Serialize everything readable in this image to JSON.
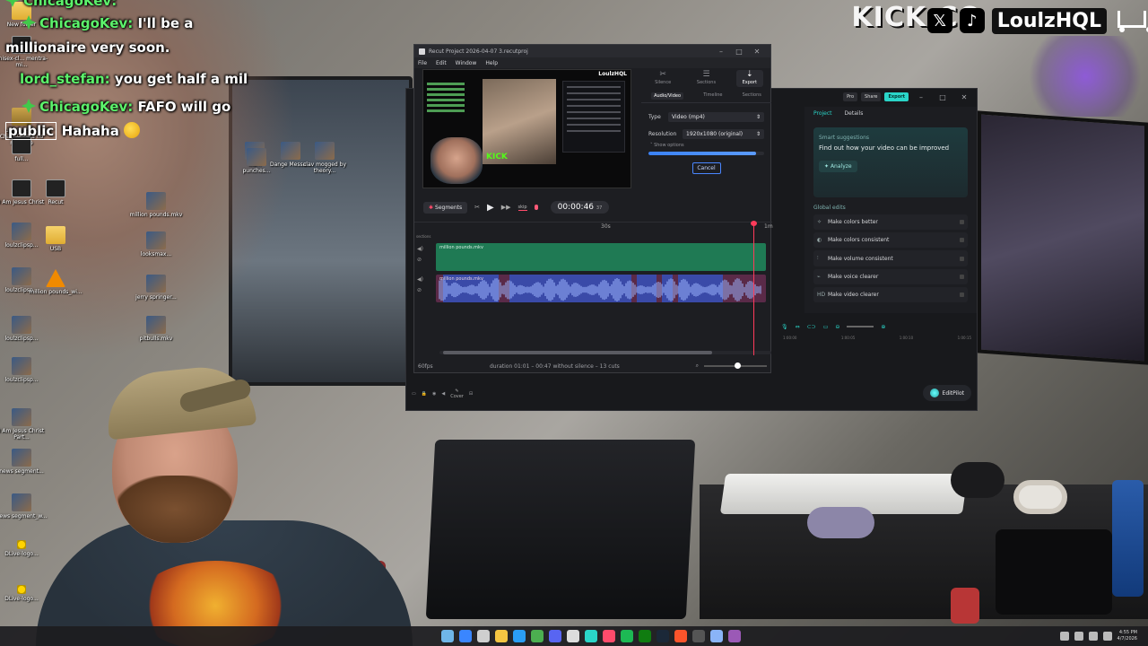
{
  "chat": [
    {
      "user": "ChicagoKev:",
      "color": "#5cf26b",
      "badge": "green",
      "message": "I'll be a millionaire very soon."
    },
    {
      "user": "lord_stefan:",
      "color": "#5cf26b",
      "badge": "none",
      "message": "you get half a mil"
    },
    {
      "user": "ChicagoKev:",
      "color": "#5cf26b",
      "badge": "green",
      "message": "FAFO will go",
      "message2": "public",
      "message3": "Hahaha"
    }
  ],
  "brand": {
    "kick": "KICK.CO",
    "name": "LoulzHQL",
    "x_icon": "x-logo-icon",
    "tiktok_icon": "tiktok-logo-icon",
    "cart_icon": "shopping-cart-icon"
  },
  "desktop_icons": [
    {
      "label": "New folder",
      "type": "folder"
    },
    {
      "label": "unisex-cl... mentra-mi...",
      "type": "app"
    },
    {
      "label": "unisex-clu... ChatTTSBeta no node.zip",
      "type": "zip"
    },
    {
      "label": "full...",
      "type": "app"
    },
    {
      "label": "I Am Jesus Christ",
      "type": "app"
    },
    {
      "label": "Recut",
      "type": "app"
    },
    {
      "label": "million pounds.mkv",
      "type": "video"
    },
    {
      "label": "loulzclipsp...",
      "type": "video"
    },
    {
      "label": "USB",
      "type": "folder"
    },
    {
      "label": "looksmax...",
      "type": "video"
    },
    {
      "label": "loulzclipsp...",
      "type": "video"
    },
    {
      "label": "million pounds_wi...",
      "type": "vlc"
    },
    {
      "label": "jerry springer...",
      "type": "video"
    },
    {
      "label": "loulzclipsp...",
      "type": "video"
    },
    {
      "label": "pitbulls.mkv",
      "type": "video"
    },
    {
      "label": "loulzclipsp...",
      "type": "video"
    },
    {
      "label": "I Am Jesus Christ Part...",
      "type": "video"
    },
    {
      "label": "news segment...",
      "type": "video"
    },
    {
      "label": "news segment_w...",
      "type": "video"
    },
    {
      "label": "DLive-logo...",
      "type": "dlive"
    },
    {
      "label": "DLive-logo...",
      "type": "dlive"
    },
    {
      "label": "kia...",
      "type": "video"
    },
    {
      "label": "punches...",
      "type": "video"
    },
    {
      "label": "Dange Messa...",
      "type": "video"
    },
    {
      "label": "clav mogged by theory...",
      "type": "video"
    }
  ],
  "recut": {
    "title": "Recut Project 2026-04-07 3.recutproj",
    "menu": [
      "File",
      "Edit",
      "Window",
      "Help"
    ],
    "preview_brand": "LoulzHQL",
    "preview_kick": "KICK",
    "segments_label": "Segments",
    "skip_label": "skip",
    "time_main": "00:00:46",
    "time_frac": "37",
    "side_tabs": [
      {
        "label": "Silence",
        "icon": "scissors-icon"
      },
      {
        "label": "Sections",
        "icon": "sections-icon"
      },
      {
        "label": "Export",
        "icon": "export-icon",
        "active": true
      }
    ],
    "sub_tabs": [
      "Audio/Video",
      "Timeline",
      "Sections"
    ],
    "type_label": "Type",
    "type_value": "Video (mp4)",
    "resolution_label": "Resolution",
    "resolution_value": "1920x1080 (original)",
    "show_options": "Show options",
    "export_progress": 0.93,
    "cancel_label": "Cancel",
    "ruler": {
      "mark_30s": "30s",
      "mark_1m": "1m"
    },
    "sections_label": "sections",
    "video_track_name": "million pounds.mkv",
    "audio_track_name": "million pounds.mkv",
    "fps": "60fps",
    "duration_text": "duration 01:01  –  00:47 without silence  –  13 cuts"
  },
  "capcut": {
    "top_pills": [
      "Pro",
      "Share",
      "Export"
    ],
    "tabs": [
      "Project",
      "Details"
    ],
    "smart_title": "Smart suggestions",
    "smart_text": "Find out how your video can be improved",
    "analyze": "Analyze",
    "global_edits": "Global edits",
    "edits": [
      {
        "label": "Make colors better",
        "icon": "wand-icon"
      },
      {
        "label": "Make colors consistent",
        "icon": "palette-icon"
      },
      {
        "label": "Make volume consistent",
        "icon": "volume-bars-icon"
      },
      {
        "label": "Make voice clearer",
        "icon": "voice-icon"
      },
      {
        "label": "Make video clearer",
        "icon": "hd-icon"
      }
    ],
    "ticks": [
      "1:00:00",
      "1:00:05",
      "1:00:10",
      "1:00:15"
    ],
    "cover_label": "Cover",
    "editpilot": "EditPilot"
  },
  "taskbar": {
    "time": "4:55 PM",
    "date": "4/7/2026",
    "icons": [
      "weather-icon",
      "start-icon",
      "search-icon",
      "file-explorer-icon",
      "edge-icon",
      "chrome-icon",
      "discord-icon",
      "obs-icon",
      "capcut-icon",
      "recut-icon",
      "spotify-icon",
      "xbox-icon",
      "steam-icon",
      "brave-icon",
      "terminal-icon",
      "notepad-icon",
      "video-icon"
    ]
  }
}
